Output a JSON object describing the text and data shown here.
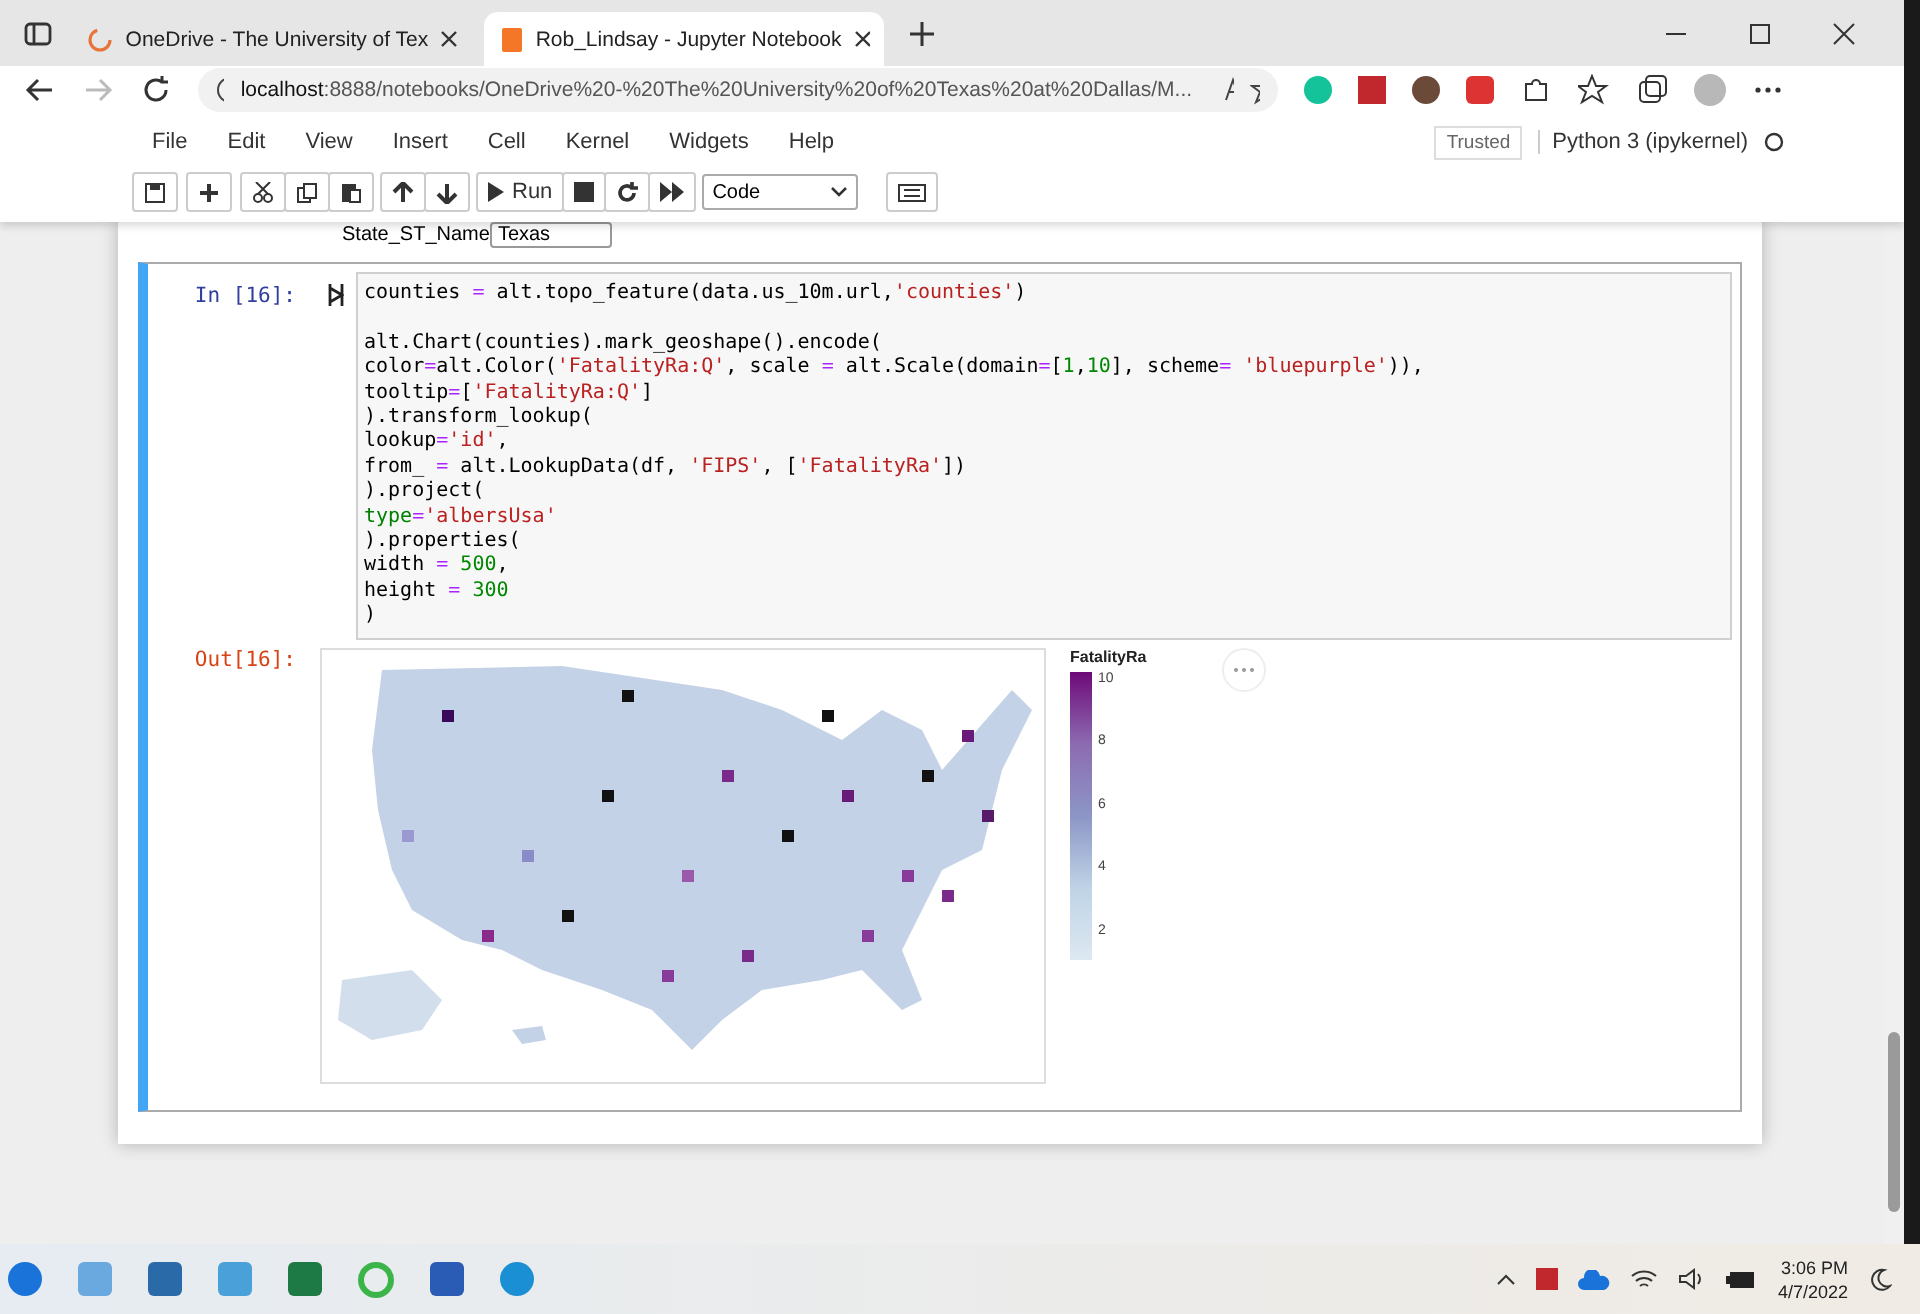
{
  "browser": {
    "tabs": [
      {
        "title": "OneDrive - The University of Tex",
        "selected": false
      },
      {
        "title": "Rob_Lindsay - Jupyter Notebook",
        "selected": true
      }
    ],
    "url_host": "localhost",
    "url_rest": ":8888/notebooks/OneDrive%20-%20The%20University%20of%20Texas%20at%20Dallas/M..."
  },
  "menu": {
    "items": [
      "File",
      "Edit",
      "View",
      "Insert",
      "Cell",
      "Kernel",
      "Widgets",
      "Help"
    ],
    "trusted": "Trusted",
    "kernel": "Python 3 (ipykernel)"
  },
  "toolbar": {
    "run": "Run",
    "cell_type": "Code"
  },
  "widget_above": {
    "label": "State_ST_Name",
    "value": "Texas"
  },
  "cell": {
    "prompt_in": "In [16]:",
    "prompt_out": "Out[16]:",
    "code_blocks": [
      [
        [
          {
            "t": "counties ",
            "kind": "plain"
          },
          {
            "t": "=",
            "kind": "op"
          },
          {
            "t": " alt.topo_feature(data.us_10m.url,",
            "kind": "plain"
          },
          {
            "t": "'counties'",
            "kind": "string"
          },
          {
            "t": ")",
            "kind": "plain"
          }
        ]
      ],
      [
        [
          {
            "t": "alt.Chart(counties).mark_geoshape().encode(",
            "kind": "plain"
          }
        ],
        [
          {
            "t": "color",
            "kind": "plain"
          },
          {
            "t": "=",
            "kind": "op"
          },
          {
            "t": "alt.Color(",
            "kind": "plain"
          },
          {
            "t": "'FatalityRa:Q'",
            "kind": "string"
          },
          {
            "t": ", scale ",
            "kind": "plain"
          },
          {
            "t": "=",
            "kind": "op"
          },
          {
            "t": " alt.Scale(domain",
            "kind": "plain"
          },
          {
            "t": "=",
            "kind": "op"
          },
          {
            "t": "[",
            "kind": "plain"
          },
          {
            "t": "1",
            "kind": "number"
          },
          {
            "t": ",",
            "kind": "plain"
          },
          {
            "t": "10",
            "kind": "number"
          },
          {
            "t": "], scheme",
            "kind": "plain"
          },
          {
            "t": "=",
            "kind": "op"
          },
          {
            "t": " 'bluepurple'",
            "kind": "string"
          },
          {
            "t": ")),",
            "kind": "plain"
          }
        ],
        [
          {
            "t": "tooltip",
            "kind": "plain"
          },
          {
            "t": "=",
            "kind": "op"
          },
          {
            "t": "[",
            "kind": "plain"
          },
          {
            "t": "'FatalityRa:Q'",
            "kind": "string"
          },
          {
            "t": "]",
            "kind": "plain"
          }
        ],
        [
          {
            "t": ").transform_lookup(",
            "kind": "plain"
          }
        ],
        [
          {
            "t": "lookup",
            "kind": "plain"
          },
          {
            "t": "=",
            "kind": "op"
          },
          {
            "t": "'id'",
            "kind": "string"
          },
          {
            "t": ",",
            "kind": "plain"
          }
        ],
        [
          {
            "t": "from_ ",
            "kind": "plain"
          },
          {
            "t": "=",
            "kind": "op"
          },
          {
            "t": " alt.LookupData(df, ",
            "kind": "plain"
          },
          {
            "t": "'FIPS'",
            "kind": "string"
          },
          {
            "t": ", [",
            "kind": "plain"
          },
          {
            "t": "'FatalityRa'",
            "kind": "string"
          },
          {
            "t": "])",
            "kind": "plain"
          }
        ],
        [
          {
            "t": ").project(",
            "kind": "plain"
          }
        ],
        [
          {
            "t": "type",
            "kind": "builtin"
          },
          {
            "t": "=",
            "kind": "op"
          },
          {
            "t": "'albersUsa'",
            "kind": "string"
          }
        ],
        [
          {
            "t": ").properties(",
            "kind": "plain"
          }
        ],
        [
          {
            "t": "width ",
            "kind": "plain"
          },
          {
            "t": "=",
            "kind": "op"
          },
          {
            "t": " 500",
            "kind": "number"
          },
          {
            "t": ",",
            "kind": "plain"
          }
        ],
        [
          {
            "t": "height ",
            "kind": "plain"
          },
          {
            "t": "=",
            "kind": "op"
          },
          {
            "t": " 300",
            "kind": "number"
          }
        ],
        [
          {
            "t": ")",
            "kind": "plain"
          }
        ]
      ]
    ],
    "legend": {
      "title": "FatalityRa",
      "ticks": [
        "10",
        "8",
        "6",
        "4",
        "2"
      ]
    }
  },
  "taskbar": {
    "time": "3:06 PM",
    "date": "4/7/2022"
  }
}
